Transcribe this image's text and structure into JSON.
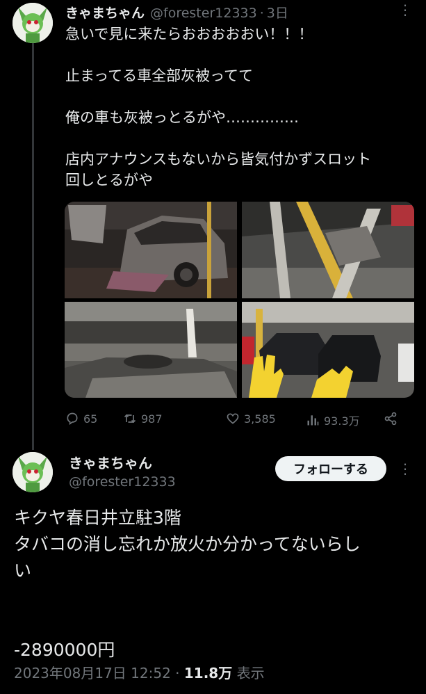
{
  "tweet1": {
    "name": "きゃまちゃん",
    "handle": "@forester12333",
    "dot": "·",
    "time": "3日",
    "lines": [
      "急いで見に来たらおおおおおい！！！",
      "止まってる車全部灰被ってて",
      "俺の車も灰被っとるがや……………",
      "店内アナウンスもないから皆気付かずスロット",
      "回しとるがや"
    ],
    "actions": {
      "replies": "65",
      "retweets": "987",
      "likes": "3,585",
      "views": "93.3万"
    }
  },
  "tweet2": {
    "name": "きゃまちゃん",
    "handle": "@forester12333",
    "follow_label": "フォローする",
    "lines": [
      "キクヤ春日井立駐3階",
      "タバコの消し忘れか放火か分かってないらし",
      "い",
      "-2890000円"
    ],
    "meta": {
      "datetime": "2023年08月17日 12:52",
      "sep": "·",
      "views": "11.8万",
      "views_suffix": "表示"
    }
  },
  "more_glyph": "⋮",
  "icons": [
    "avatar",
    "more-icon",
    "reply-icon",
    "retweet-icon",
    "like-icon",
    "views-icon",
    "share-icon"
  ],
  "colors": {
    "background": "#000000",
    "text": "#e7e9ea",
    "muted": "#71767b",
    "button_bg": "#eff3f4"
  }
}
